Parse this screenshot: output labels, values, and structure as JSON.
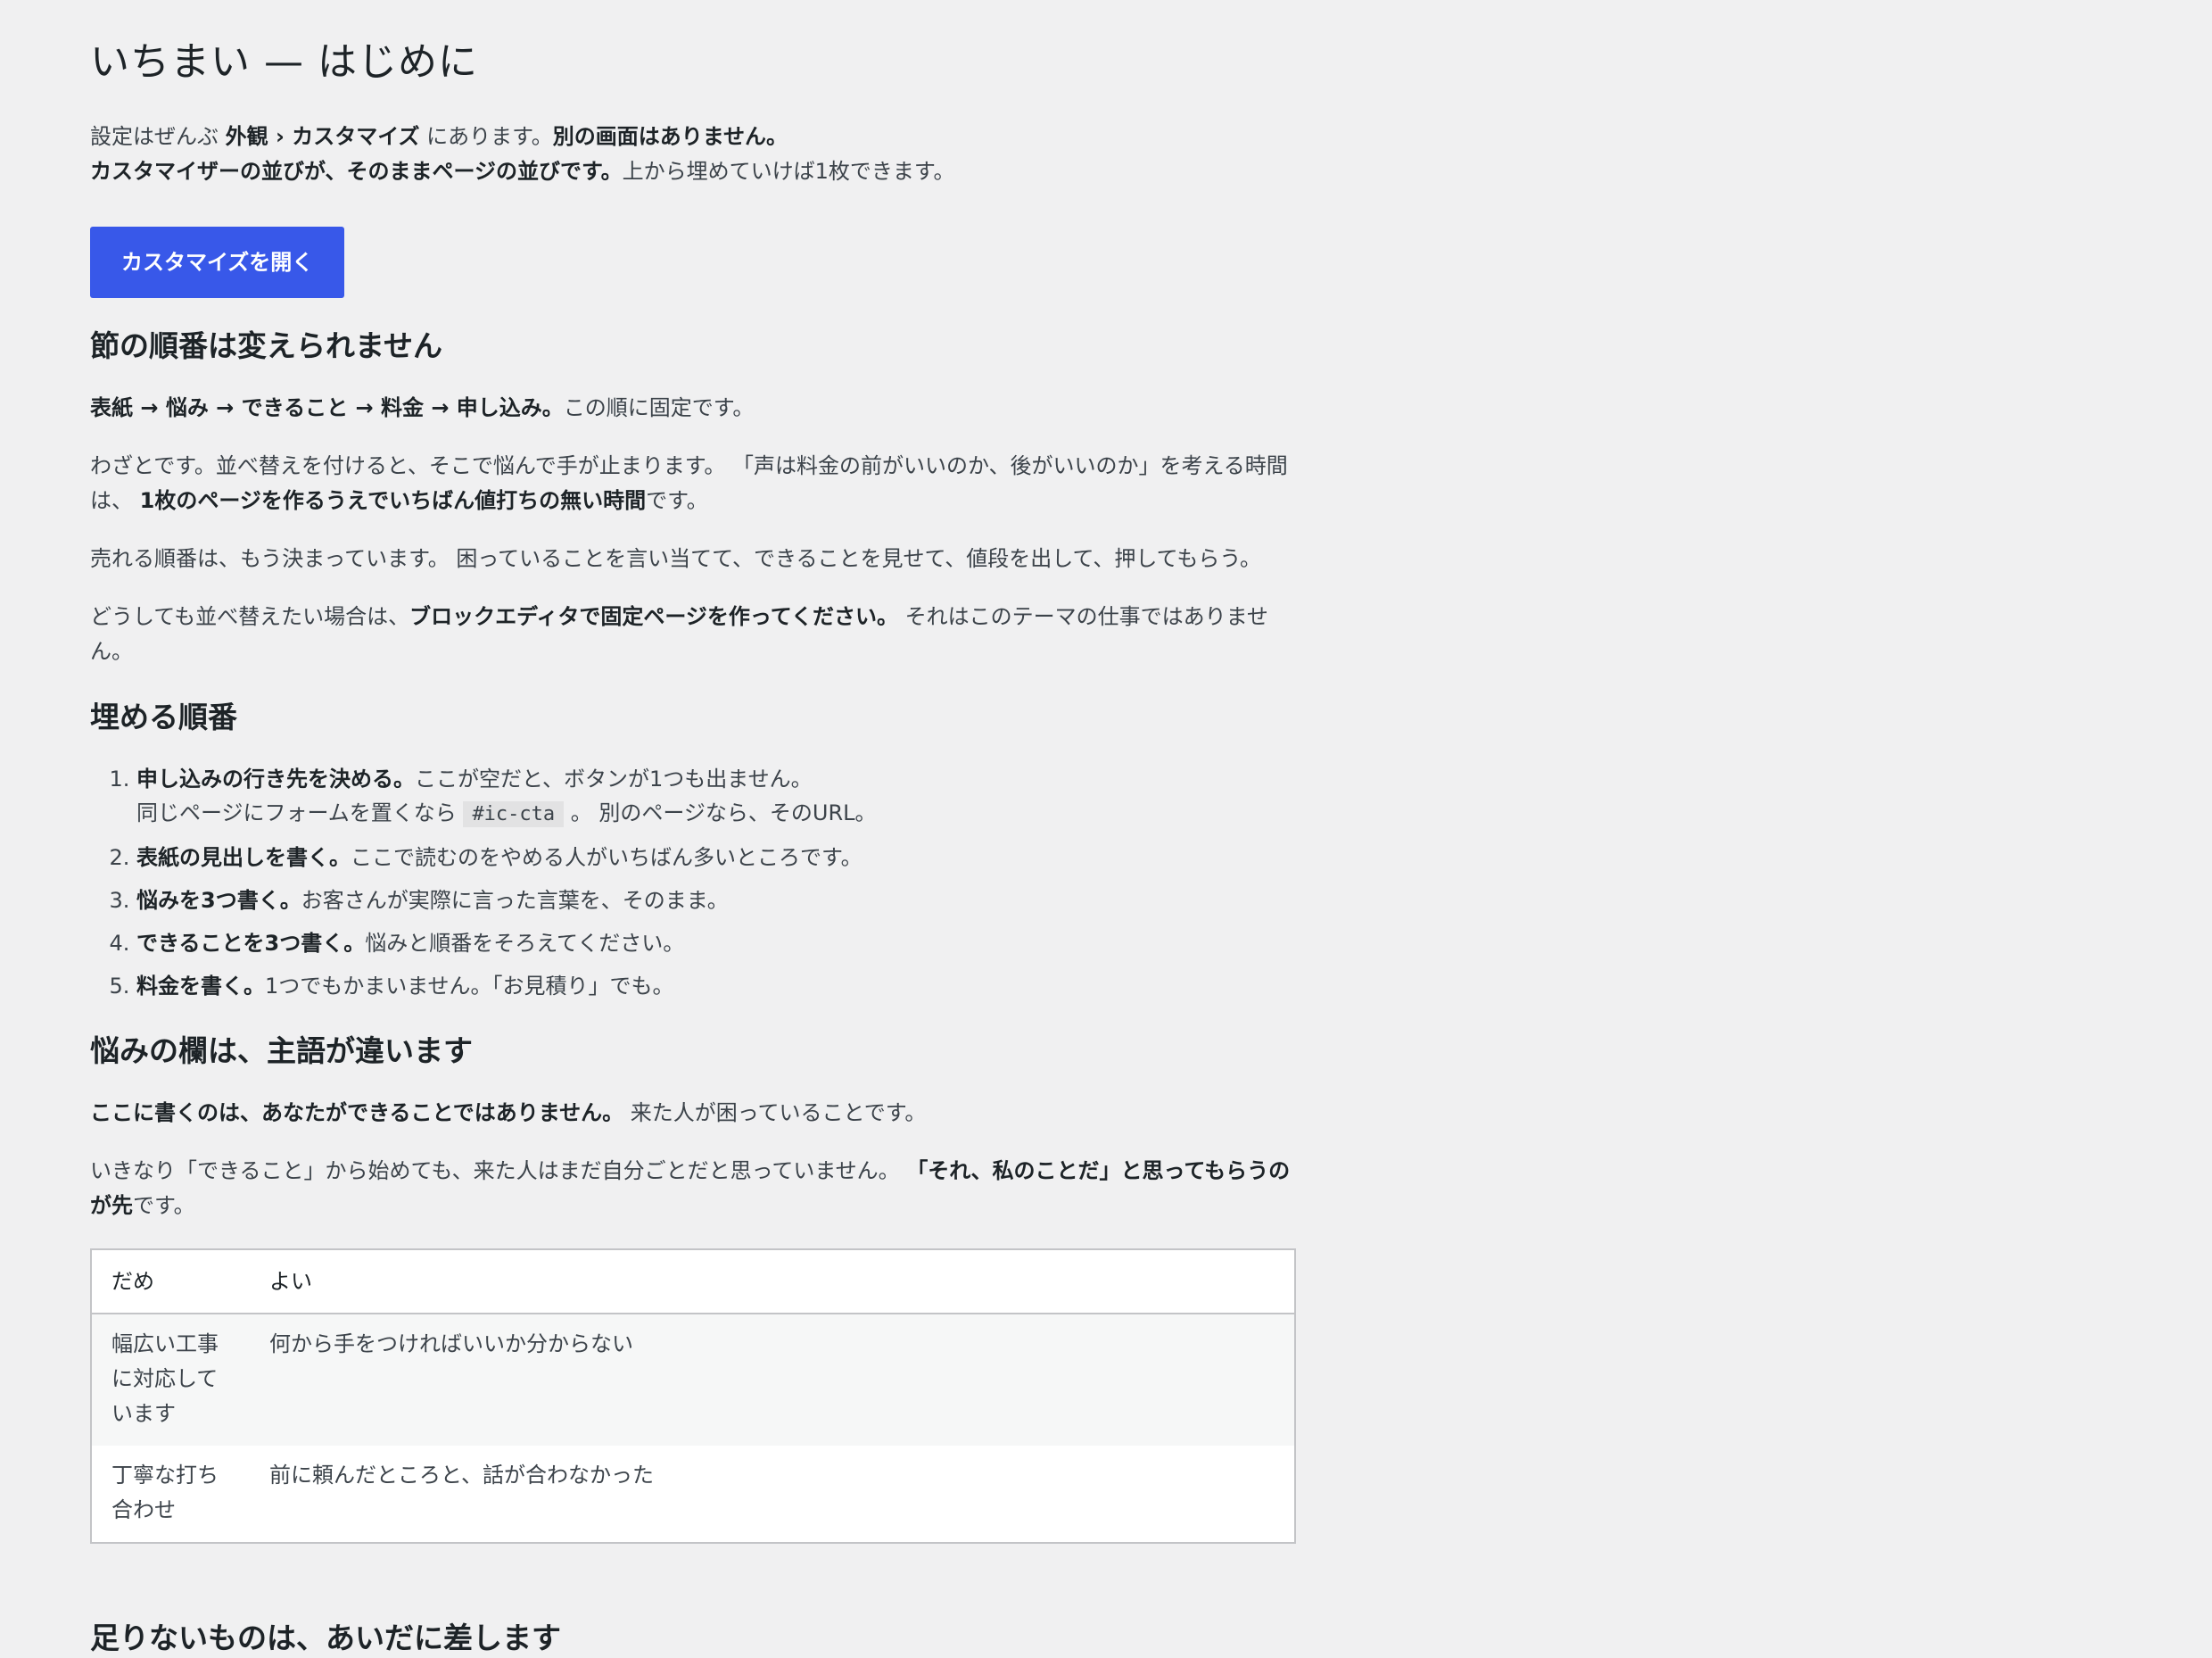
{
  "title": "いちまい — はじめに",
  "intro": {
    "l1a": "設定はぜんぶ ",
    "l1b": "外観 › カスタマイズ",
    "l1c": " にあります。",
    "l1d": "別の画面はありません。",
    "l2a": "カスタマイザーの並びが、そのままページの並びです。",
    "l2b": "上から埋めていけば1枚できます。"
  },
  "button": "カスタマイズを開く",
  "sec1": {
    "heading": "節の順番は変えられません",
    "p1b": "表紙 → 悩み → できること → 料金 → 申し込み。",
    "p1": "この順に固定です。",
    "p2a": "わざとです。並べ替えを付けると、そこで悩んで手が止まります。 「声は料金の前がいいのか、後がいいのか」を考える時間は、 ",
    "p2b": "1枚のページを作るうえでいちばん値打ちの無い時間",
    "p2c": "です。",
    "p3": "売れる順番は、もう決まっています。 困っていることを言い当てて、できることを見せて、値段を出して、押してもらう。",
    "p4a": "どうしても並べ替えたい場合は、",
    "p4b": "ブロックエディタで固定ページを作ってください。",
    "p4c": " それはこのテーマの仕事ではありません。"
  },
  "sec2": {
    "heading": "埋める順番",
    "items": [
      {
        "b": "申し込みの行き先を決める。",
        "t": "ここが空だと、ボタンが1つも出ません。",
        "sub_a": "同じページにフォームを置くなら ",
        "code": "#ic-cta",
        "sub_b": " 。 別のページなら、そのURL。"
      },
      {
        "b": "表紙の見出しを書く。",
        "t": "ここで読むのをやめる人がいちばん多いところです。"
      },
      {
        "b": "悩みを3つ書く。",
        "t": "お客さんが実際に言った言葉を、そのまま。"
      },
      {
        "b": "できることを3つ書く。",
        "t": "悩みと順番をそろえてください。"
      },
      {
        "b": "料金を書く。",
        "t": "1つでもかまいません。「お見積り」でも。"
      }
    ]
  },
  "sec3": {
    "heading": "悩みの欄は、主語が違います",
    "p1b": "ここに書くのは、あなたができることではありません。",
    "p1": " 来た人が困っていることです。",
    "p2a": "いきなり「できること」から始めても、来た人はまだ自分ごとだと思っていません。 ",
    "p2b": "「それ、私のことだ」と思ってもらうのが先",
    "p2c": "です。",
    "table": {
      "headers": [
        "だめ",
        "よい"
      ],
      "rows": [
        [
          "幅広い工事に対応しています",
          "何から手をつければいいか分からない"
        ],
        [
          "丁寧な打ち合わせ",
          "前に頼んだところと、話が合わなかった"
        ]
      ]
    }
  },
  "sec4": {
    "heading": "足りないものは、あいだに差します"
  }
}
